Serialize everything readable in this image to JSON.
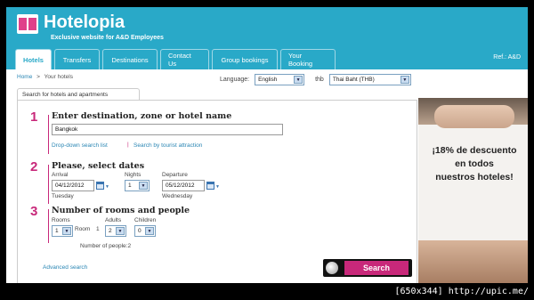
{
  "header": {
    "brand": "Hotelopia",
    "tagline": "Exclusive website for A&D Employees",
    "ref": "Ref.: A&D"
  },
  "tabs": [
    {
      "label": "Hotels",
      "active": true
    },
    {
      "label": "Transfers",
      "active": false
    },
    {
      "label": "Destinations",
      "active": false
    },
    {
      "label": "Contact Us",
      "active": false
    },
    {
      "label": "Group bookings",
      "active": false
    },
    {
      "label": "Your Booking",
      "active": false
    }
  ],
  "breadcrumb": {
    "home": "Home",
    "separator": ">",
    "current": "Your hotels"
  },
  "language": {
    "label": "Language:",
    "value": "English"
  },
  "currency": {
    "label": "thb",
    "value": "Thai Baht (THB)"
  },
  "form": {
    "tab_label": "Search for hotels and apartments",
    "step1": {
      "number": "1",
      "title": "Enter destination, zone or hotel name",
      "destination_value": "Bangkok",
      "link_dropdown": "Drop-down search list",
      "link_separator": "|",
      "link_tourist": "Search by tourist attraction"
    },
    "step2": {
      "number": "2",
      "title": "Please, select dates",
      "arrival_label": "Arrival",
      "arrival_value": "04/12/2012",
      "arrival_day": "Tuesday",
      "nights_label": "Nights",
      "nights_value": "1",
      "departure_label": "Departure",
      "departure_value": "05/12/2012",
      "departure_day": "Wednesday"
    },
    "step3": {
      "number": "3",
      "title": "Number of rooms and people",
      "rooms_label": "Rooms",
      "rooms_value": "1",
      "room_label": "Room",
      "room_number": "1",
      "adults_label": "Adults",
      "adults_value": "2",
      "children_label": "Children",
      "children_value": "0",
      "people_count": "Number of people:2"
    },
    "advanced_search": "Advanced search",
    "search_button": "Search"
  },
  "ad": {
    "line1": "¡18% de descuento",
    "line2": "en todos",
    "line3": "nuestros hoteles!"
  },
  "watermark": "[650x344] http://upic.me/",
  "colors": {
    "brand": "#29a9c8",
    "accent": "#c8287a",
    "link": "#2a86b4"
  }
}
